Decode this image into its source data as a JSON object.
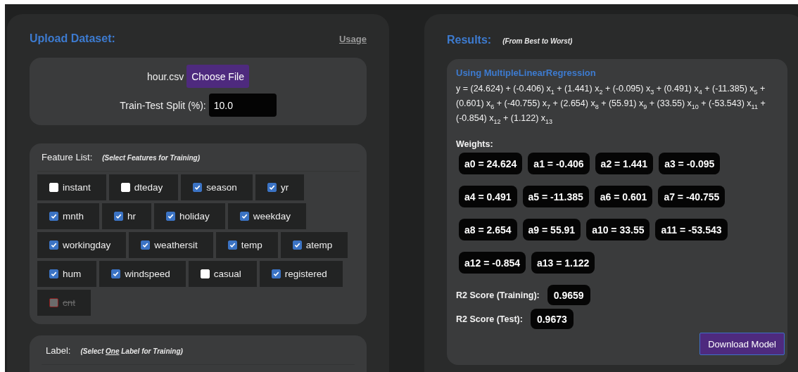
{
  "upload": {
    "title": "Upload Dataset:",
    "usage_link": "Usage",
    "file_name": "hour.csv",
    "choose_button": "Choose File",
    "split_label": "Train-Test Split (%):",
    "split_value": "10.0"
  },
  "features": {
    "title": "Feature List:",
    "hint": "(Select Features for Training)",
    "items": [
      {
        "name": "instant",
        "checked": false,
        "disabled": false
      },
      {
        "name": "dteday",
        "checked": false,
        "disabled": false
      },
      {
        "name": "season",
        "checked": true,
        "disabled": false
      },
      {
        "name": "yr",
        "checked": true,
        "disabled": false
      },
      {
        "name": "mnth",
        "checked": true,
        "disabled": false
      },
      {
        "name": "hr",
        "checked": true,
        "disabled": false
      },
      {
        "name": "holiday",
        "checked": true,
        "disabled": false
      },
      {
        "name": "weekday",
        "checked": true,
        "disabled": false
      },
      {
        "name": "workingday",
        "checked": true,
        "disabled": false
      },
      {
        "name": "weathersit",
        "checked": true,
        "disabled": false
      },
      {
        "name": "temp",
        "checked": true,
        "disabled": false
      },
      {
        "name": "atemp",
        "checked": true,
        "disabled": false
      },
      {
        "name": "hum",
        "checked": true,
        "disabled": false
      },
      {
        "name": "windspeed",
        "checked": true,
        "disabled": false
      },
      {
        "name": "casual",
        "checked": false,
        "disabled": false
      },
      {
        "name": "registered",
        "checked": true,
        "disabled": false
      },
      {
        "name": "cnt",
        "checked": false,
        "disabled": true
      }
    ]
  },
  "label_section": {
    "title": "Label:",
    "hint": [
      "(Select ",
      "One",
      " Label for Training)"
    ]
  },
  "results": {
    "title": "Results:",
    "hint": "(From Best to Worst)",
    "model": {
      "name": "Using MultipleLinearRegression",
      "equation": "y = (24.624) + (-0.406) x$_{1}$ + (1.441) x$_{2}$ + (-0.095) x$_{3}$ + (0.491) x$_{4}$ + (-11.385) x$_{5}$ + (0.601) x$_{6}$ + (-40.755) x$_{7}$ + (2.654) x$_{8}$ + (55.91) x$_{9}$ + (33.55) x$_{10}$ + (-53.543) x$_{11}$ + (-0.854) x$_{12}$ + (1.122) x$_{13}$",
      "weights_title": "Weights:",
      "weights": [
        "a0 = 24.624",
        "a1 = -0.406",
        "a2 = 1.441",
        "a3 = -0.095",
        "a4 = 0.491",
        "a5 = -11.385",
        "a6 = 0.601",
        "a7 = -40.755",
        "a8 = 2.654",
        "a9 = 55.91",
        "a10 = 33.55",
        "a11 = -53.543",
        "a12 = -0.854",
        "a13 = 1.122"
      ],
      "scores": [
        {
          "label": "R2 Score (Training):",
          "value": "0.9659"
        },
        {
          "label": "R2 Score (Test):",
          "value": "0.9673"
        }
      ],
      "download_button": "Download Model"
    }
  }
}
